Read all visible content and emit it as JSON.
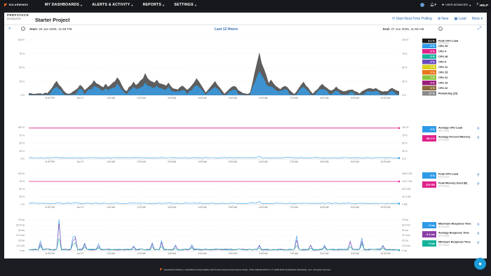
{
  "nav": {
    "brand": "SOLARWINDS",
    "items": [
      "MY DASHBOARDS",
      "ALERTS & ACTIVITY",
      "REPORTS",
      "SETTINGS"
    ],
    "badge": "1",
    "user": "USER ADVANCED",
    "help": "HELP"
  },
  "header": {
    "brand_line1": "PERFSTACK",
    "brand_line2": "analysis",
    "title": "Starter Project",
    "actions": [
      "Start Real-Time Polling",
      "New",
      "Load",
      "More"
    ]
  },
  "range": {
    "start_label": "Start:",
    "start_value": "26 Jun 2025, 11:59 PM",
    "label": "Last 12 Hours",
    "end_label": "End:",
    "end_value": "27 Jun 2025, 11:59 AM"
  },
  "charts": {
    "xticks": [
      "11:30 PM",
      "Jun 27",
      "1:00 AM",
      "2:00 AM",
      "3:00 AM",
      "4:00 AM",
      "5:00 AM",
      "6:00 AM",
      "7:00 AM",
      "8:00 AM",
      "9:00 AM",
      "10:00 AM"
    ],
    "p1_left": [
      "100 %",
      "75 %",
      "50 %",
      "25 %",
      "0 %"
    ],
    "p1_right": [
      "100 %",
      "75 %",
      "50 %",
      "25 %",
      "0 %"
    ],
    "p2_left": [
      "100 %",
      "75 %",
      "50 %",
      "25 %",
      "0 %"
    ],
    "p2_right": [
      "100 %",
      "75 %",
      "50 %",
      "25 %",
      "0 %"
    ],
    "p3_left": [
      "100 %",
      "75 %",
      "50 %",
      "25 %",
      "0 %"
    ],
    "p3_right": [
      "164.9 GB",
      "123.7 GB",
      "82.5 GB",
      "41.2 GB",
      "0 GB"
    ],
    "p4_left": [
      "75 ms",
      "62.5 ms",
      "50 ms",
      "37.5 ms",
      "25 ms",
      "12.5 ms",
      "0 ms"
    ],
    "p4_right": [
      "75 ms",
      "62.5 ms",
      "50 ms",
      "37.5 ms",
      "25 ms",
      "12.5 ms",
      "0 ms"
    ]
  },
  "legend1": [
    {
      "value": "3.1 %",
      "label": "Peak CPU Load",
      "sub": "NOCTQL01",
      "color": "#1a1a1a"
    },
    {
      "value": "0 %",
      "label": "CPU 29",
      "color": "#2f9be8"
    },
    {
      "value": "0 %",
      "label": "CPU 4",
      "color": "#e0218a"
    },
    {
      "value": "0 %",
      "label": "CPU 28",
      "color": "#16b39c"
    },
    {
      "value": "0 %",
      "label": "CPU 9",
      "color": "#6a4bbf"
    },
    {
      "value": "1 %",
      "label": "CPU 11",
      "color": "#d8d11a"
    },
    {
      "value": "1 %",
      "label": "CPU 15",
      "color": "#e8741a"
    },
    {
      "value": "1 %",
      "label": "CPU 31",
      "color": "#8ac43f"
    },
    {
      "value": "0 %",
      "label": "CPU 14",
      "color": "#9a1e7a"
    },
    {
      "value": "1 %",
      "label": "CPU 22",
      "color": "#8a6a3a"
    },
    {
      "value": "27 %",
      "label": "Remaining (23)",
      "color": "#8a8a8a"
    }
  ],
  "legend2": [
    {
      "value": "3 %",
      "label": "Average CPU Load",
      "sub": "NOCTQL01",
      "color": "#2f9be8"
    },
    {
      "value": "98.2 %",
      "label": "Average Percent Memory",
      "sub": "NOCTQL01",
      "color": "#e0218a"
    }
  ],
  "legend3": [
    {
      "value": "3 %",
      "label": "Peak CPU Load",
      "sub": "NOCTQL01",
      "color": "#2f9be8"
    },
    {
      "value": "123 GB",
      "label": "Peak Memory Used (B)",
      "sub": "NOCTQL01",
      "color": "#e0218a"
    }
  ],
  "legend4": [
    {
      "value": "0 ms",
      "label": "Maximum Response Time",
      "sub": "NOCTQL01",
      "color": "#2f9be8"
    },
    {
      "value": "0.3 ms",
      "label": "Average Response Time",
      "sub": "NOCTQL01",
      "color": "#8a3fa8"
    },
    {
      "value": "0 ms",
      "label": "Minimum Response Time",
      "sub": "NOCTQL01",
      "color": "#16b39c"
    }
  ],
  "footer": "SolarWinds Platform, SolarWinds Observability Self-Hosted Advanced Enterprise Scale, 2.5M, SPANE 2025.2.2 © 1995-2025 SolarWinds Worldwide, LLC. All rights reserved."
}
